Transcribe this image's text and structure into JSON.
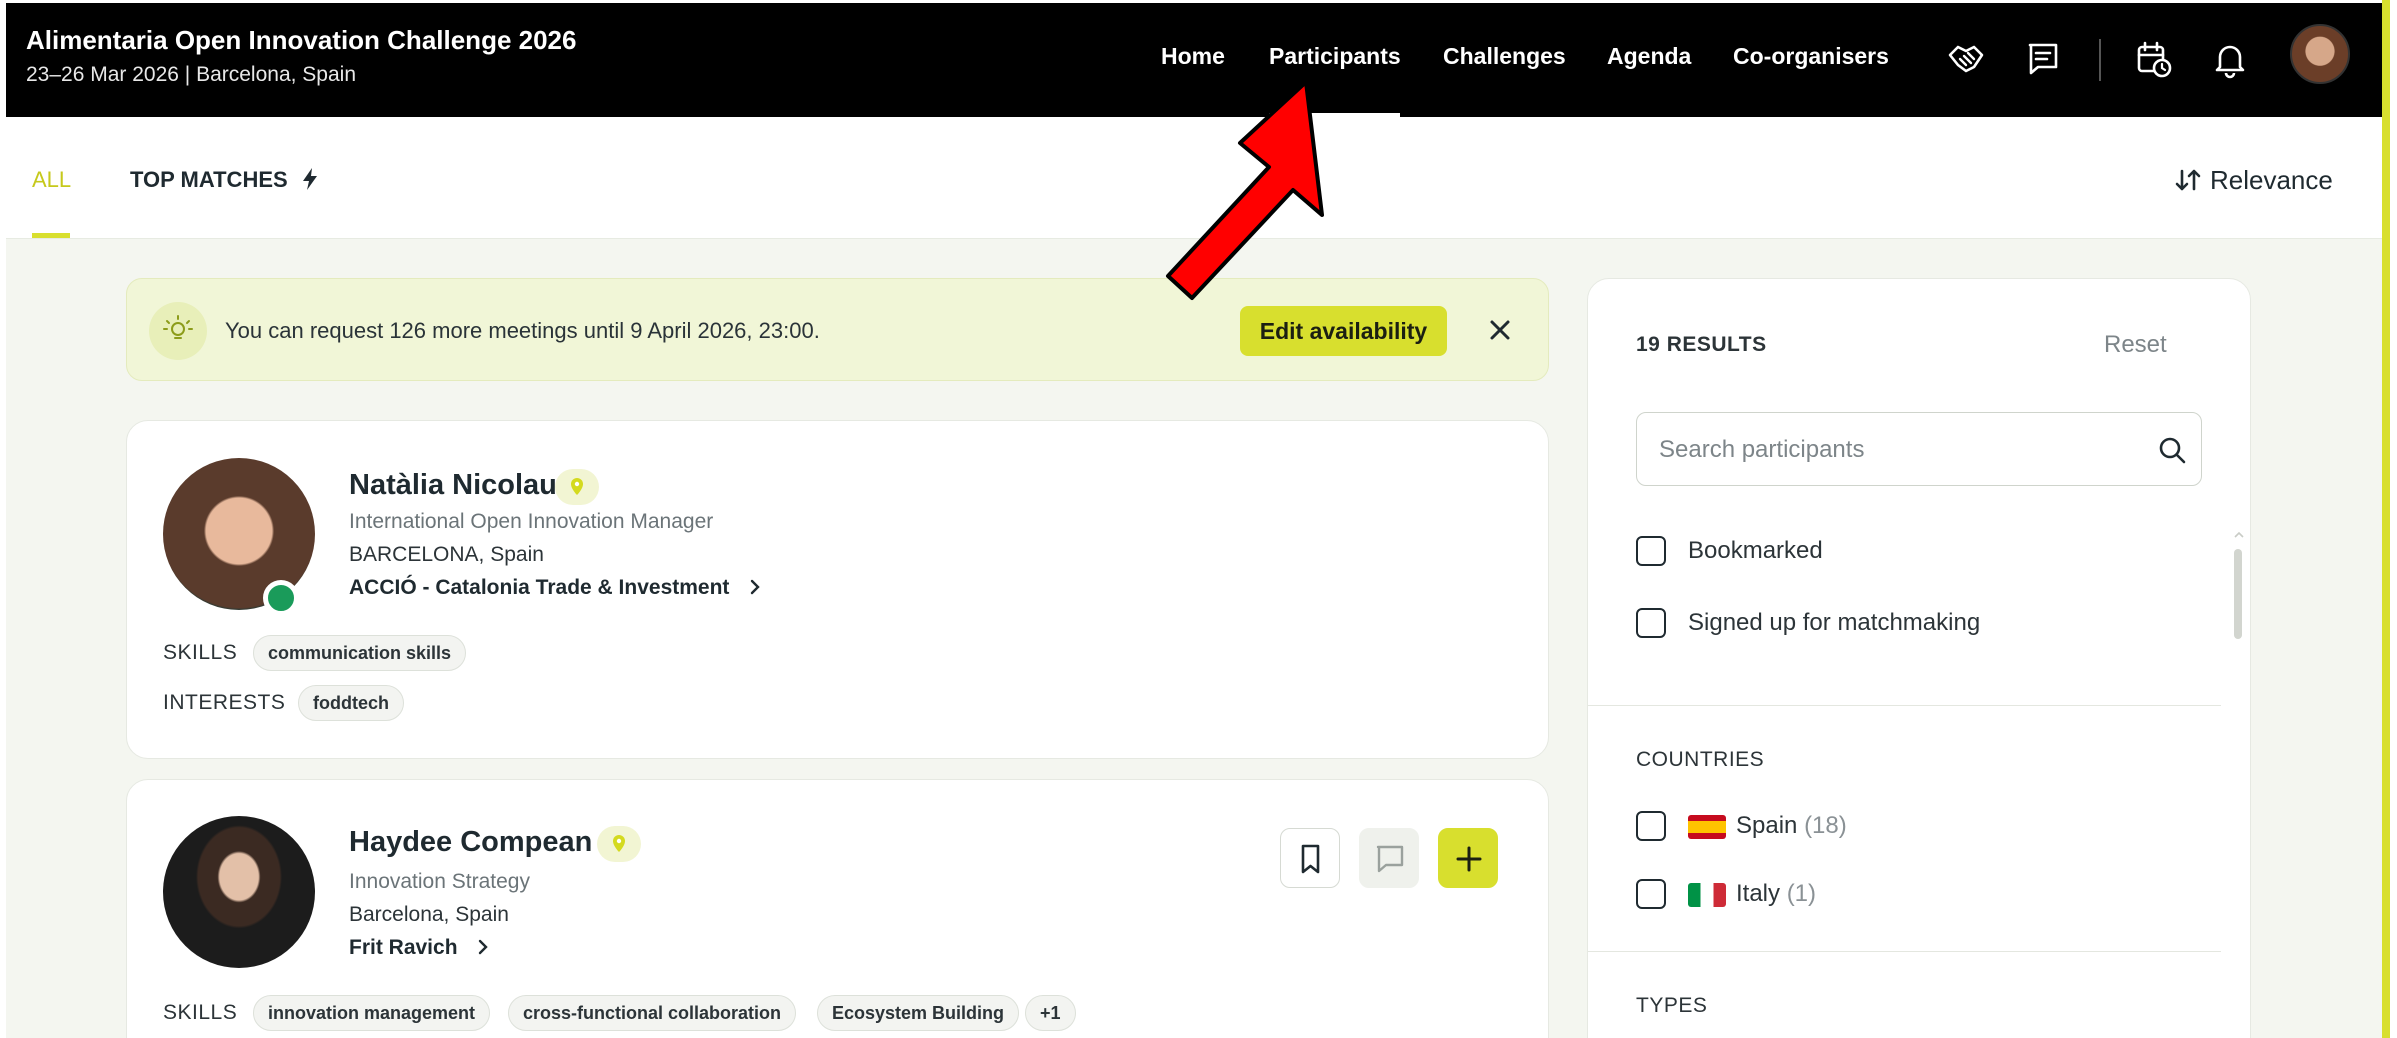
{
  "event": {
    "title": "Alimentaria Open Innovation Challenge 2026",
    "subtitle": "23–26 Mar 2026 | Barcelona, Spain"
  },
  "nav": {
    "home": "Home",
    "participants": "Participants",
    "challenges": "Challenges",
    "agenda": "Agenda",
    "coorganisers": "Co-organisers",
    "active": "Participants",
    "icons": [
      "handshake-icon",
      "message-icon",
      "calendar-clock-icon",
      "bell-icon",
      "user-avatar"
    ]
  },
  "tabs": {
    "all": "ALL",
    "top_matches": "TOP MATCHES",
    "sort_label": "Relevance"
  },
  "banner": {
    "text": "You can request 126 more meetings until 9 April 2026, 23:00.",
    "button": "Edit availability"
  },
  "participants": [
    {
      "name": "Natàlia Nicolau",
      "role": "International Open Innovation Manager",
      "location": "BARCELONA, Spain",
      "organization": "ACCIÓ - Catalonia Trade & Investment",
      "skills_label": "SKILLS",
      "skills": [
        "communication skills"
      ],
      "interests_label": "INTERESTS",
      "interests": [
        "foddtech"
      ],
      "online": true
    },
    {
      "name": "Haydee Compean",
      "role": "Innovation Strategy",
      "location": "Barcelona, Spain",
      "organization": "Frit Ravich",
      "skills_label": "SKILLS",
      "skills": [
        "innovation management",
        "cross-functional collaboration",
        "Ecosystem Building",
        "+1"
      ]
    }
  ],
  "filters": {
    "results": "19 RESULTS",
    "reset": "Reset",
    "search_placeholder": "Search participants",
    "bookmarked": "Bookmarked",
    "signed_up": "Signed up for matchmaking",
    "countries_title": "COUNTRIES",
    "countries": [
      {
        "name": "Spain",
        "count": "(18)"
      },
      {
        "name": "Italy",
        "count": "(1)"
      }
    ],
    "types_title": "TYPES"
  },
  "colors": {
    "accent": "#d8df2e",
    "topbar": "#000000",
    "online": "#1a9b5a",
    "annotation_arrow": "#ff0000"
  }
}
